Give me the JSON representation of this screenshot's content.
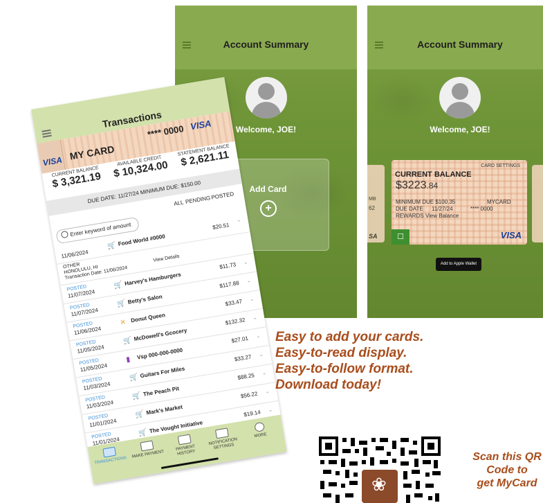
{
  "screen_a": {
    "title": "Account Summary",
    "welcome": "Welcome, JOE!",
    "add_card_label": "Add Card"
  },
  "screen_b": {
    "title": "Account Summary",
    "welcome": "Welcome, JOE!",
    "card": {
      "settings": "CARD SETTINGS",
      "heading": "CURRENT BALANCE",
      "balance_main": "$3223",
      "balance_cents": ".84",
      "min_due": "MINIMUM DUE $100.35",
      "card_name": "MYCARD",
      "due_date_label": "DUE DATE",
      "due_date": "11/27/24",
      "card_last4": "**** 0000",
      "rewards": "REWARDS View Balance",
      "network": "VISA"
    },
    "side_left": [
      "MB",
      "62",
      "SA"
    ],
    "wallet": "Add to Apple Wallet"
  },
  "phone": {
    "title": "Transactions",
    "card_name": "MY CARD",
    "card_number": "**** 0000",
    "network": "VISA",
    "left_network": "VISA",
    "balances": [
      {
        "caption": "CURRENT BALANCE",
        "value": "$ 3,321.19"
      },
      {
        "caption": "AVAILABLE CREDIT",
        "value": "$ 10,324.00"
      },
      {
        "caption": "STATEMENT BALANCE",
        "value": "$ 2,621.11"
      }
    ],
    "due_line": "DUE DATE: 11/27/24   MINIMUM DUE: $150.00",
    "filters": [
      "ALL",
      "PENDING",
      "POSTED"
    ],
    "search_placeholder": "Enter keyword of amount",
    "first_tx": {
      "date": "11/06/2024",
      "merchant": "Food World #0000",
      "amount": "$20.51"
    },
    "expanded": {
      "location": "OTHER",
      "city": "HONOLULU, HI",
      "txn_date": "Transaction Date: 11/06/2024",
      "details": "View Details"
    },
    "transactions": [
      {
        "status": "POSTED",
        "date": "11/07/2024",
        "merchant": "Harvey's Hamburgers",
        "amount": "$11.73"
      },
      {
        "status": "POSTED",
        "date": "11/07/2024",
        "merchant": "Betty's Salon",
        "amount": "$117.88"
      },
      {
        "status": "POSTED",
        "date": "11/06/2024",
        "merchant": "Donut Queen",
        "amount": "$33.47"
      },
      {
        "status": "POSTED",
        "date": "11/05/2024",
        "merchant": "McDowell's Gcocery",
        "amount": "$132.32"
      },
      {
        "status": "POSTED",
        "date": "11/05/2024",
        "merchant": "Vsp 000-000-0000",
        "amount": "$27.01"
      },
      {
        "status": "POSTED",
        "date": "11/03/2024",
        "merchant": "Guitars For Miles",
        "amount": "$33.27"
      },
      {
        "status": "POSTED",
        "date": "11/03/2024",
        "merchant": "The Peach Pit",
        "amount": "$88.25"
      },
      {
        "status": "POSTED",
        "date": "11/01/2024",
        "merchant": "Mark's Market",
        "amount": "$56.22"
      },
      {
        "status": "POSTED",
        "date": "11/01/2024",
        "merchant": "The Vought Initiative",
        "amount": "$19.14"
      }
    ],
    "nav": [
      {
        "label": "TRANSACTIONS"
      },
      {
        "label": "MAKE PAYMENT"
      },
      {
        "label": "PAYMENT HISTORY"
      },
      {
        "label": "NOTIFICATION SETTINGS"
      },
      {
        "label": "MORE"
      }
    ]
  },
  "marketing": {
    "lines": [
      "Easy to add your cards.",
      "Easy-to-read display.",
      "Easy-to-follow format.",
      "Download today!"
    ],
    "scan": [
      "Scan this QR",
      "Code to",
      "get MyCard"
    ]
  },
  "colors": {
    "brand_green": "#7fa044",
    "tagline": "#a84d1c",
    "card_peach": "#f4d7bf",
    "link_blue": "#3b8fd8"
  }
}
